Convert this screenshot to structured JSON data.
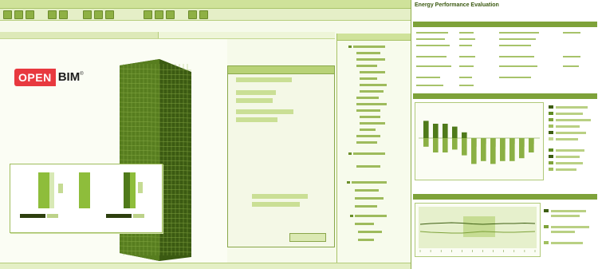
{
  "logo": {
    "part1": "OPEN",
    "part2": "BIM",
    "mark": "®"
  },
  "report": {
    "title": "Energy Performance Evaluation"
  },
  "colors": {
    "accent": "#7ea23a",
    "logo_red": "#e8393f",
    "background": "#f6faea"
  },
  "chart_data": [
    {
      "type": "bar",
      "series": [
        {
          "values": [
            6,
            5,
            5,
            4,
            2,
            -3,
            -2,
            -3,
            -4,
            -2,
            -3,
            -2
          ]
        },
        {
          "values": [
            -3,
            -5,
            -5,
            -4,
            -6,
            -9,
            -8,
            -9,
            -8,
            -8,
            -7,
            -5
          ]
        }
      ]
    },
    {
      "type": "line",
      "series": [
        {
          "values": [
            0.6,
            0.62,
            0.63,
            0.64,
            0.63,
            0.61,
            0.6,
            0.61,
            0.62,
            0.62,
            0.63,
            0.62
          ]
        },
        {
          "values": [
            0.42,
            0.4,
            0.39,
            0.38,
            0.38,
            0.4,
            0.42,
            0.41,
            0.4,
            0.4,
            0.41,
            0.42
          ]
        }
      ]
    }
  ]
}
